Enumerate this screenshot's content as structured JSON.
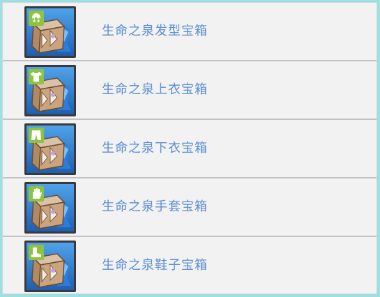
{
  "colors": {
    "background": "#9edfe0",
    "panel": "#f2f2f2",
    "divider": "#c3c3c3",
    "label_text": "#5b8ed4",
    "badge_green": "#8cc33f",
    "icon_blue": "#2d7fd3"
  },
  "items": [
    {
      "label": "生命之泉发型宝箱",
      "badge_icon": "hair-icon"
    },
    {
      "label": "生命之泉上衣宝箱",
      "badge_icon": "shirt-icon"
    },
    {
      "label": "生命之泉下衣宝箱",
      "badge_icon": "pants-icon"
    },
    {
      "label": "生命之泉手套宝箱",
      "badge_icon": "glove-icon"
    },
    {
      "label": "生命之泉鞋子宝箱",
      "badge_icon": "boot-icon"
    }
  ]
}
